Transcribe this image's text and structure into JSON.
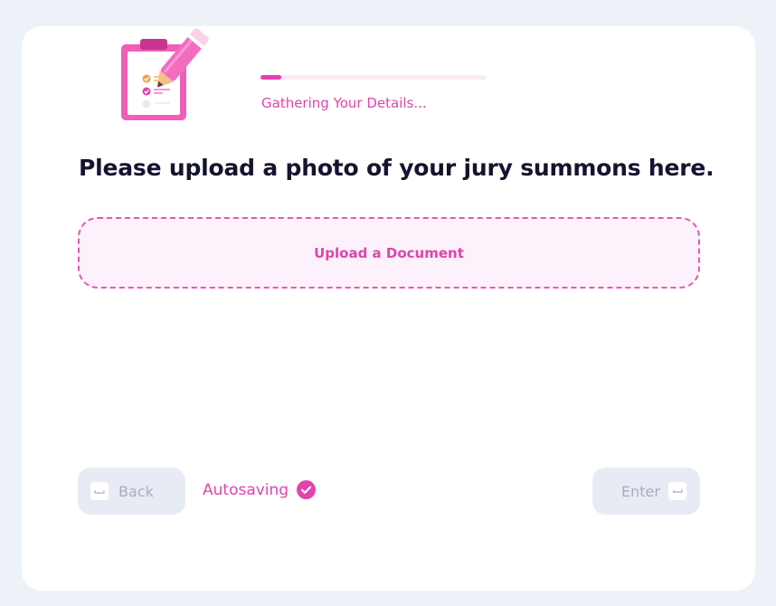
{
  "progress": {
    "label": "Gathering Your Details...",
    "fraction": 0.09
  },
  "question": {
    "text": "Please upload a photo of your jury summons here."
  },
  "upload": {
    "label": "Upload a Document"
  },
  "footer": {
    "back_label": "Back",
    "autosave_label": "Autosaving",
    "enter_label": "Enter"
  },
  "icons": {
    "illustration": "clipboard-pencil-icon",
    "back_key": "keyboard-key-icon",
    "enter_key": "enter-key-icon",
    "autosave": "check-circle-icon"
  },
  "colors": {
    "accent": "#e243ad",
    "background": "#edf1f8",
    "button": "#e7ebf4",
    "heading": "#14142f"
  }
}
